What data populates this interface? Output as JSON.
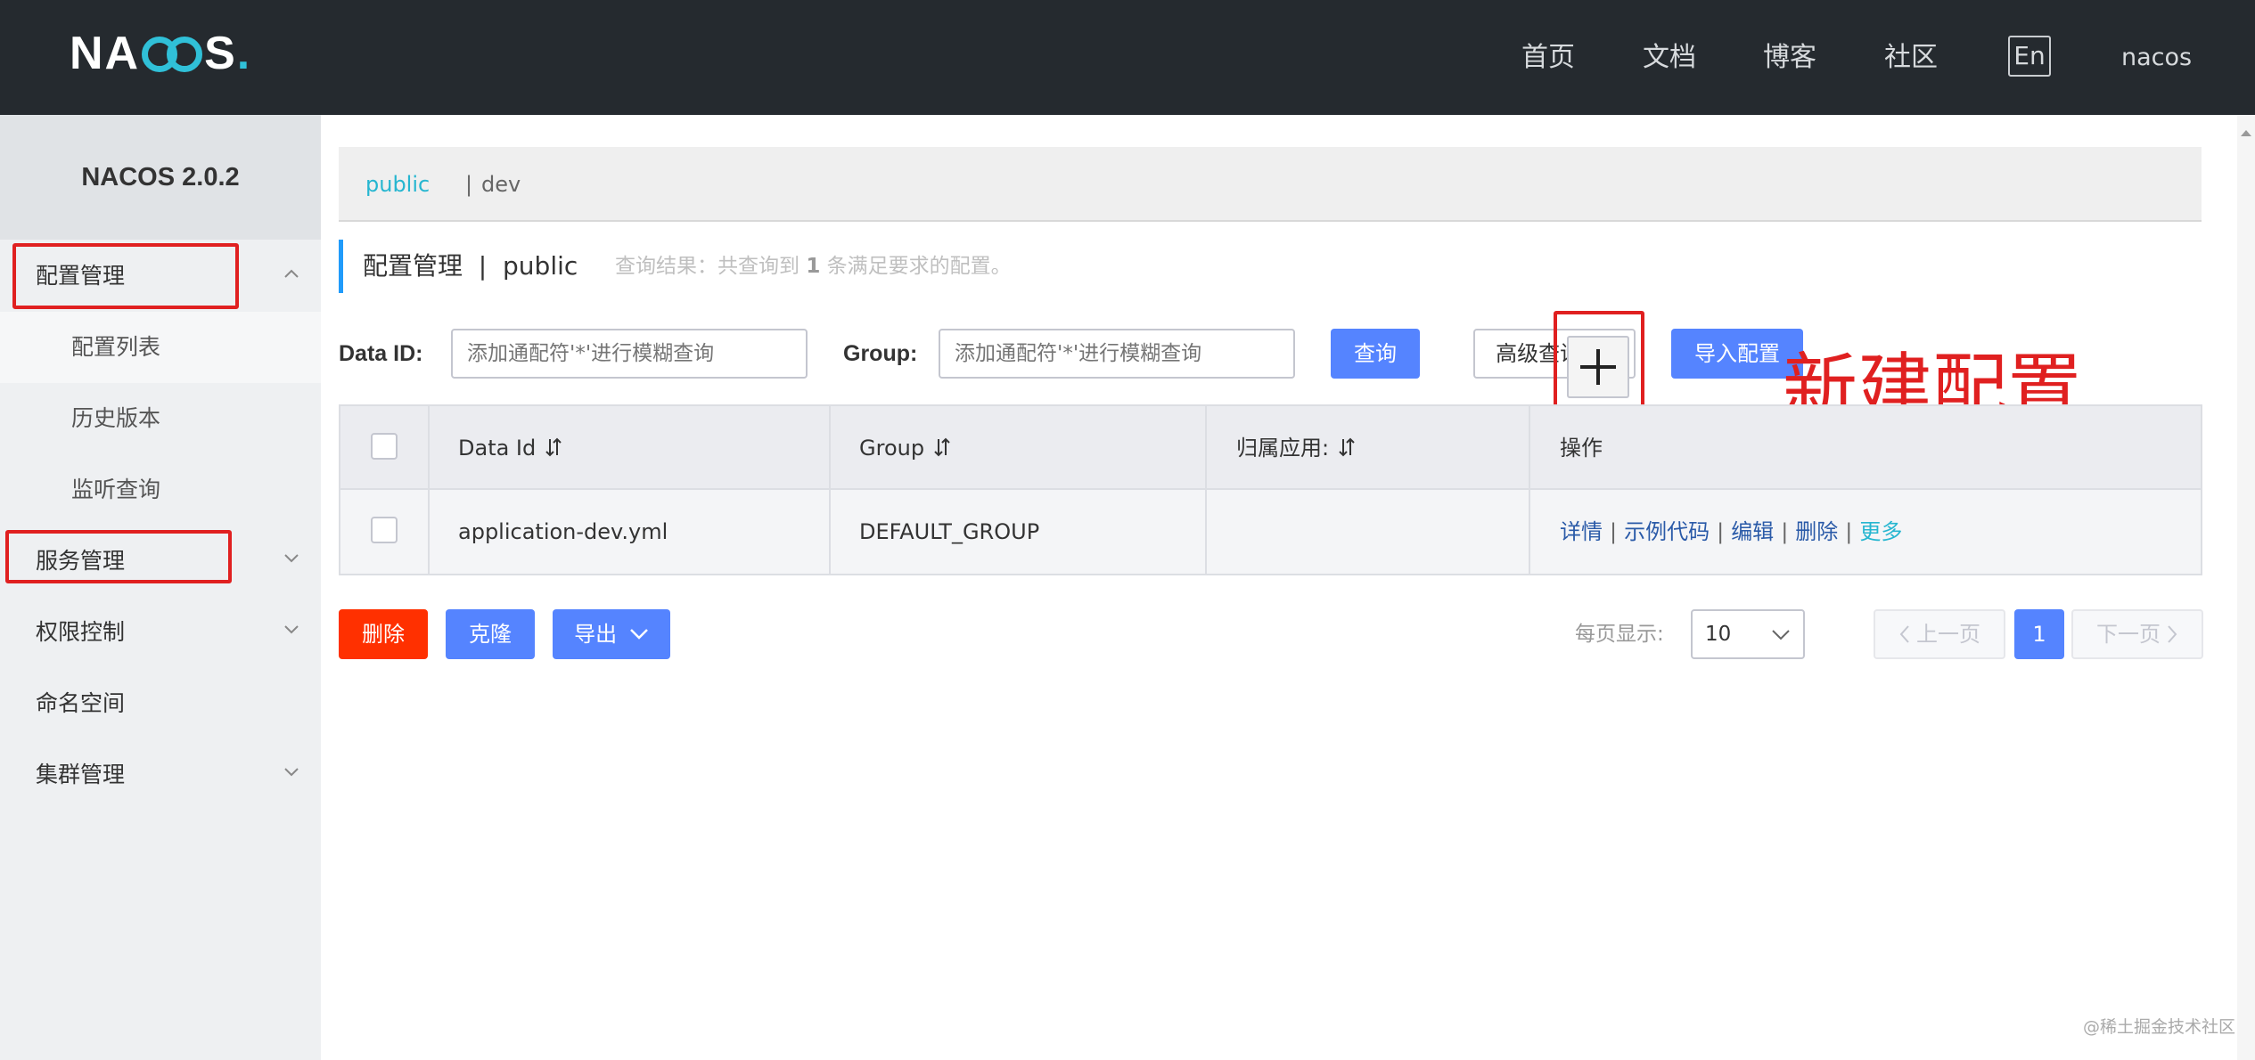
{
  "header": {
    "logo_text": "NACOS.",
    "nav": [
      "首页",
      "文档",
      "博客",
      "社区"
    ],
    "lang_button": "En",
    "user": "nacos"
  },
  "sidebar": {
    "title": "NACOS 2.0.2",
    "items": [
      {
        "label": "配置管理",
        "expanded": true
      },
      {
        "label": "配置列表",
        "sub": true
      },
      {
        "label": "历史版本",
        "sub": true
      },
      {
        "label": "监听查询",
        "sub": true
      },
      {
        "label": "服务管理",
        "expanded": false
      },
      {
        "label": "权限控制",
        "expanded": false
      },
      {
        "label": "命名空间"
      },
      {
        "label": "集群管理",
        "expanded": false
      }
    ]
  },
  "namespace_bar": {
    "active": "public",
    "separator": "|",
    "other": "dev"
  },
  "page_title": {
    "main": "配置管理  |  public",
    "result_prefix": "查询结果：共查询到",
    "result_count": "1",
    "result_suffix": "条满足要求的配置。"
  },
  "search": {
    "data_id_label": "Data ID:",
    "data_id_placeholder": "添加通配符'*'进行模糊查询",
    "group_label": "Group:",
    "group_placeholder": "添加通配符'*'进行模糊查询",
    "query_button": "查询",
    "advanced_button": "高级查询",
    "import_button": "导入配置"
  },
  "annotation": "新建配置",
  "table": {
    "headers": [
      "Data Id",
      "Group",
      "归属应用:",
      "操作"
    ],
    "rows": [
      {
        "data_id": "application-dev.yml",
        "group": "DEFAULT_GROUP",
        "app": "",
        "ops": [
          "详情",
          "示例代码",
          "编辑",
          "删除",
          "更多"
        ]
      }
    ]
  },
  "bulk_actions": {
    "delete": "删除",
    "clone": "克隆",
    "export": "导出"
  },
  "pagination": {
    "page_size_label": "每页显示:",
    "page_size": "10",
    "prev": "上一页",
    "current": "1",
    "next": "下一页"
  },
  "watermark": "@稀土掘金技术社区",
  "colors": {
    "accent": "#5584ff",
    "danger": "#ff3000",
    "link": "#2a5aa8",
    "teal": "#26b6d0",
    "header_bg": "#252a2f",
    "annotation_red": "#e02020"
  }
}
